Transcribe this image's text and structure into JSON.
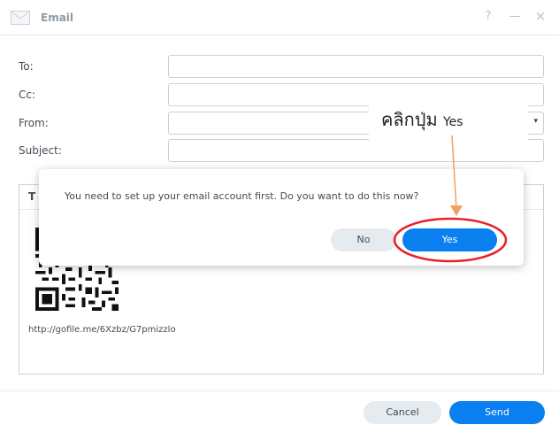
{
  "window": {
    "title": "Email",
    "help_label": "?",
    "minimize_label": "—",
    "close_label": "×"
  },
  "form": {
    "to_label": "To:",
    "cc_label": "Cc:",
    "from_label": "From:",
    "subject_label": "Subject:",
    "to_value": "",
    "cc_value": "",
    "from_value": "",
    "subject_value": "",
    "dropdown_caret": "▾"
  },
  "editor": {
    "format_icon_label": "T",
    "link_text": "http://gofile.me/6Xzbz/G7pmizzlo"
  },
  "footer": {
    "cancel_label": "Cancel",
    "send_label": "Send"
  },
  "dialog": {
    "message": "You need to set up your email account first. Do you want to do this now?",
    "no_label": "No",
    "yes_label": "Yes"
  },
  "annotation": {
    "thai_text": "คลิกปุ่ม",
    "yes_text": "Yes",
    "color": "#e8212a",
    "arrow_color": "#f0a060"
  },
  "colors": {
    "accent": "#0a7ff0",
    "secondary_button": "#e6ebf0",
    "border": "#c8d1da"
  }
}
